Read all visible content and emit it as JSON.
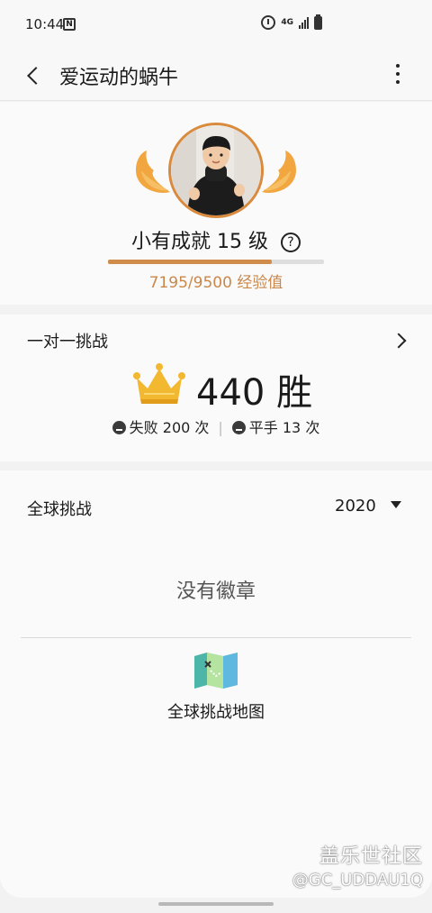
{
  "status_bar": {
    "time": "10:44",
    "network": "4G"
  },
  "header": {
    "title": "爱运动的蜗牛"
  },
  "profile": {
    "level_text": "小有成就 15 级",
    "help_symbol": "?",
    "exp_text": "7195/9500 经验值",
    "exp_current": 7195,
    "exp_max": 9500,
    "accent_color": "#cf8c4a"
  },
  "duel": {
    "title": "一对一挑战",
    "wins": "440 胜",
    "losses": "失败 200 次",
    "draws": "平手 13 次",
    "separator": "|"
  },
  "global": {
    "title": "全球挑战",
    "year": "2020",
    "empty_text": "没有徽章",
    "map_label": "全球挑战地图"
  },
  "watermark": {
    "brand": "盖乐世社区",
    "user": "@GC_UDDAU1Q"
  },
  "icons": [
    "back-icon",
    "more-icon",
    "help-icon",
    "chevron-right-icon",
    "crown-icon",
    "map-icon",
    "alarm-icon",
    "battery-icon"
  ]
}
